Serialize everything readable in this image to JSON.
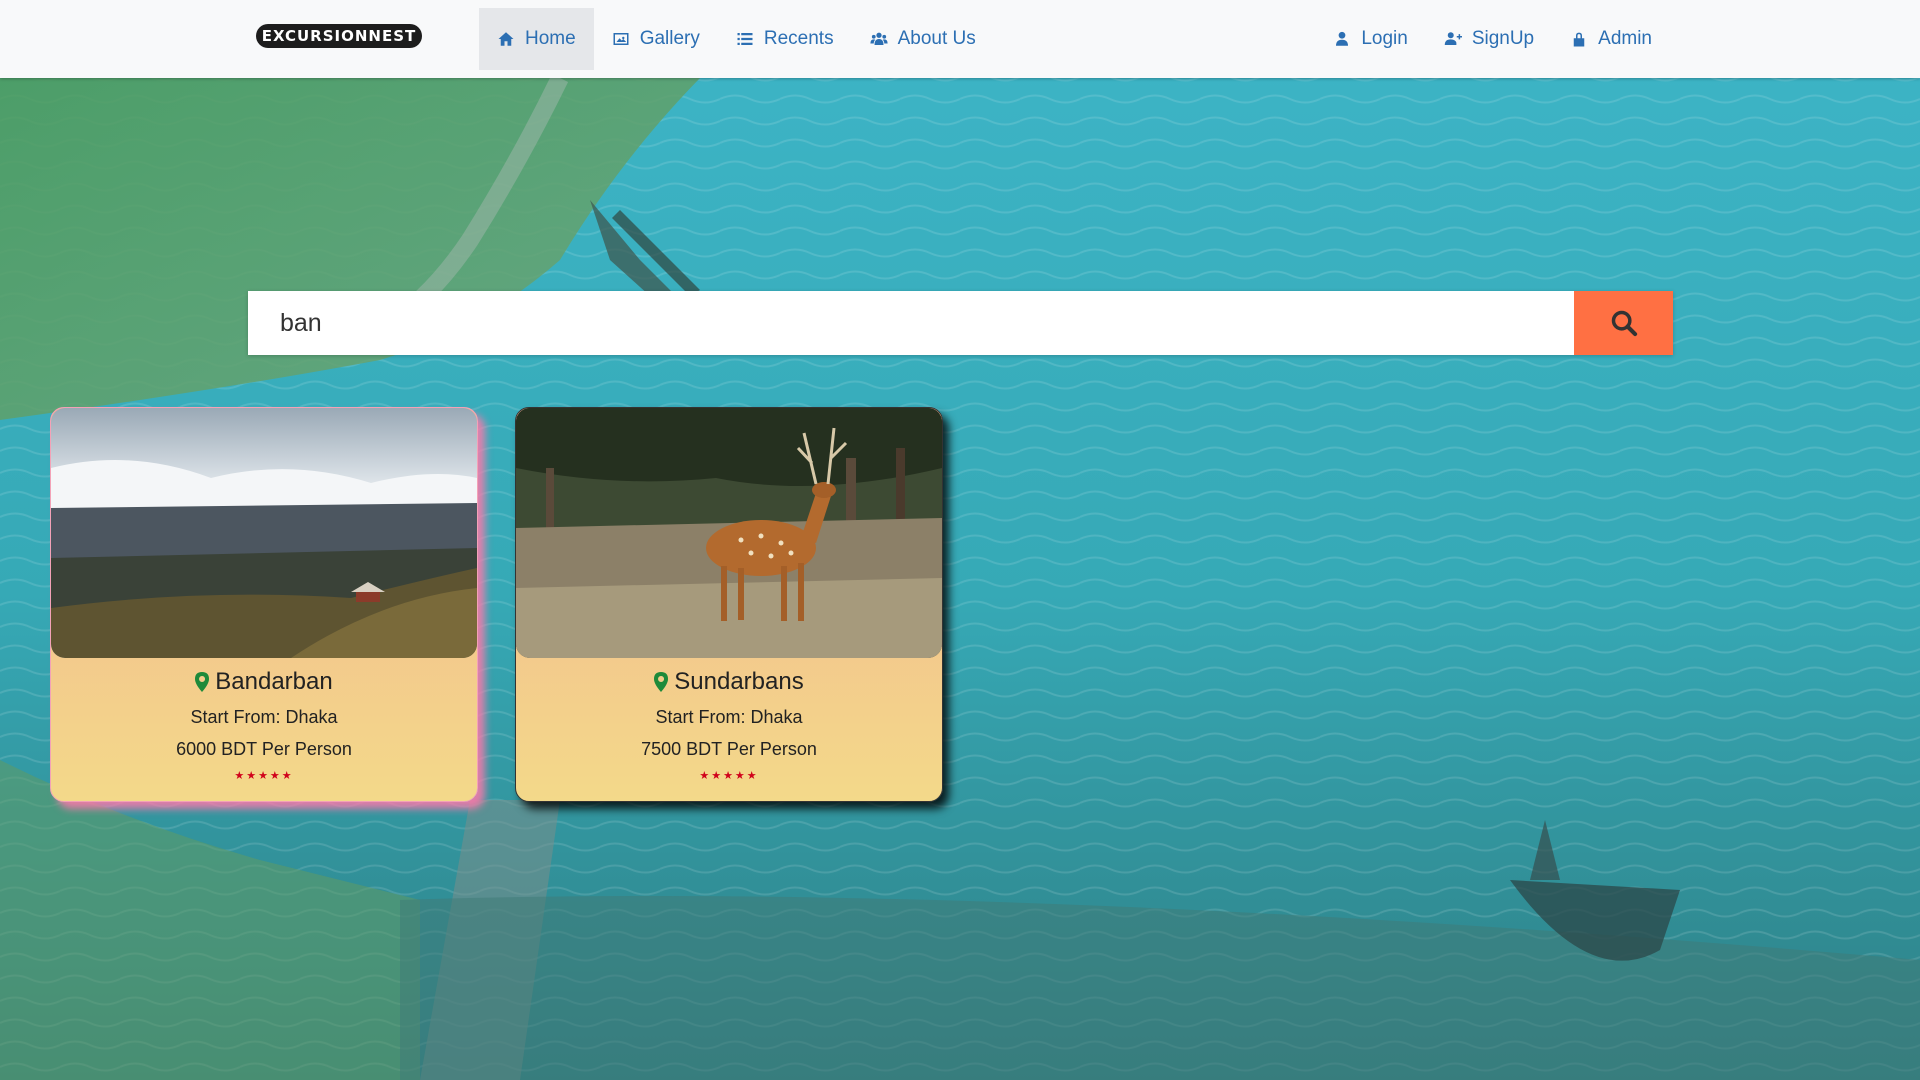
{
  "brand": {
    "name": "EXCURSIONNEST"
  },
  "nav": {
    "left": [
      {
        "label": "Home",
        "icon": "home-icon",
        "active": true
      },
      {
        "label": "Gallery",
        "icon": "image-icon",
        "active": false
      },
      {
        "label": "Recents",
        "icon": "list-icon",
        "active": false
      },
      {
        "label": "About Us",
        "icon": "users-icon",
        "active": false
      }
    ],
    "right": [
      {
        "label": "Login",
        "icon": "user-icon"
      },
      {
        "label": "SignUp",
        "icon": "user-plus-icon"
      },
      {
        "label": "Admin",
        "icon": "lock-icon"
      }
    ]
  },
  "search": {
    "value": "ban",
    "button_icon": "search-icon"
  },
  "cards": [
    {
      "name": "Bandarban",
      "start": "Start From: Dhaka",
      "price": "6000 BDT Per Person",
      "stars": "★★★★★",
      "rating": 5
    },
    {
      "name": "Sundarbans",
      "start": "Start From: Dhaka",
      "price": "7500 BDT Per Person",
      "stars": "★★★★★",
      "rating": 5
    }
  ],
  "colors": {
    "nav_link": "#2c6fb3",
    "search_button": "#ff7043",
    "star": "#d0021b",
    "pin": "#1e8a3a"
  }
}
